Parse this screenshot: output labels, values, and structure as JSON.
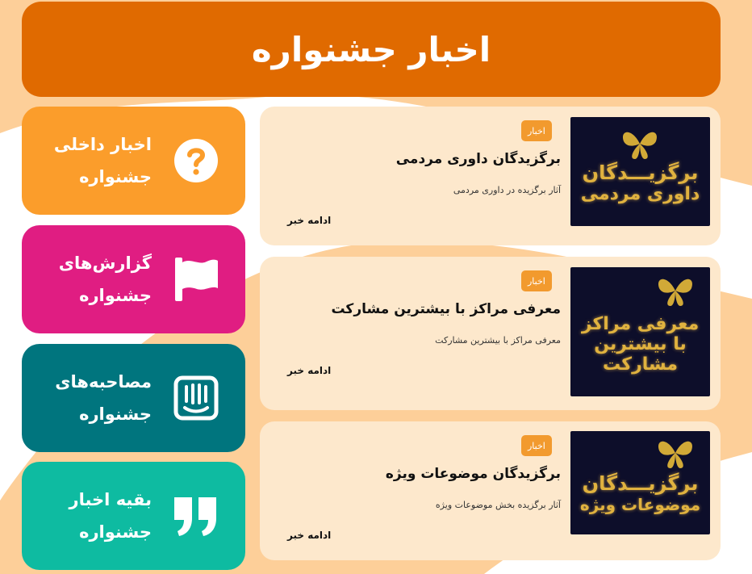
{
  "header": {
    "title": "اخبار جشنواره"
  },
  "categories": [
    {
      "label_line1": "اخبار داخلی",
      "label_line2": "جشنواره",
      "icon": "question-circle-icon",
      "color": "#fb9d2b"
    },
    {
      "label_line1": "گزارش‌های",
      "label_line2": "جشنواره",
      "icon": "flag-icon",
      "color": "#e01d82"
    },
    {
      "label_line1": "مصاحبه‌های",
      "label_line2": "جشنواره",
      "icon": "chat-bubble-icon",
      "color": "#00757e"
    },
    {
      "label_line1": "بقیه اخبار",
      "label_line2": "جشنواره",
      "icon": "quote-icon",
      "color": "#0ebba1"
    }
  ],
  "news": [
    {
      "badge": "اخبار",
      "title": "برگزیدگان داوری مردمی",
      "excerpt": "آثار برگزیده در داوری مردمی",
      "more": "ادامه خبر",
      "thumb_line1": "برگزیـــدگان",
      "thumb_line2": "داوری مردمی"
    },
    {
      "badge": "اخبار",
      "title": "معرفی مراکز با بیشترین مشارکت",
      "excerpt": "معرفی مراکز با بیشترین مشارکت",
      "more": "ادامه خبر",
      "thumb_line1": "معرفی مراکز",
      "thumb_line2": "با بیشترین",
      "thumb_line3": "مشارکت"
    },
    {
      "badge": "اخبار",
      "title": "برگزیدگان موضوعات ویژه",
      "excerpt": "آثار برگزیده بخش موضوعات ویژه",
      "more": "ادامه خبر",
      "thumb_line1": "برگزیـــدگان",
      "thumb_line2": "موضوعات ویژه"
    }
  ],
  "colors": {
    "header_bg": "#e06a00",
    "card_bg": "#fde8cc",
    "badge": "#f29a2e",
    "wave": "#fdcf99"
  }
}
